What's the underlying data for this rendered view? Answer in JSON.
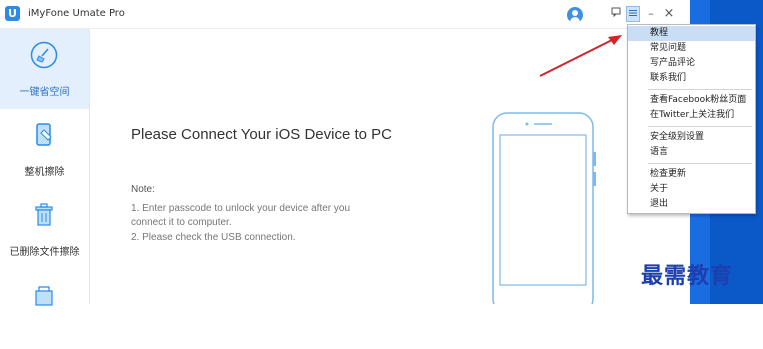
{
  "app": {
    "title": "iMyFone Umate Pro",
    "logo_letter": "U"
  },
  "titlebar": {
    "feedback_icon": "feedback-icon",
    "menu_icon": "menu-icon",
    "minimize_label": "–",
    "close_label": "×"
  },
  "sidebar": {
    "items": [
      {
        "label": "一键省空间",
        "icon": "broom-icon",
        "active": true
      },
      {
        "label": "整机擦除",
        "icon": "phone-erase-icon",
        "active": false
      },
      {
        "label": "已删除文件擦除",
        "icon": "trash-icon",
        "active": false
      },
      {
        "label": "",
        "icon": "privacy-icon",
        "active": false
      }
    ]
  },
  "main": {
    "title": "Please Connect Your iOS Device to PC",
    "note_heading": "Note:",
    "note_lines": [
      "1. Enter passcode to unlock your device after you",
      "connect it to computer.",
      "2. Please check the USB connection."
    ]
  },
  "menu": {
    "groups": [
      [
        "教程",
        "常见问题",
        "写产品评论",
        "联系我们"
      ],
      [
        "查看Facebook粉丝页面",
        "在Twitter上关注我们"
      ],
      [
        "安全级别设置",
        "语言"
      ],
      [
        "检查更新",
        "关于",
        "退出"
      ]
    ],
    "highlighted": "教程"
  },
  "watermark": {
    "text": "最需教育"
  },
  "colors": {
    "accent": "#2a8be8",
    "highlight": "#c9def5",
    "sidebar_active": "#e3effc",
    "arrow": "#d0242a"
  }
}
